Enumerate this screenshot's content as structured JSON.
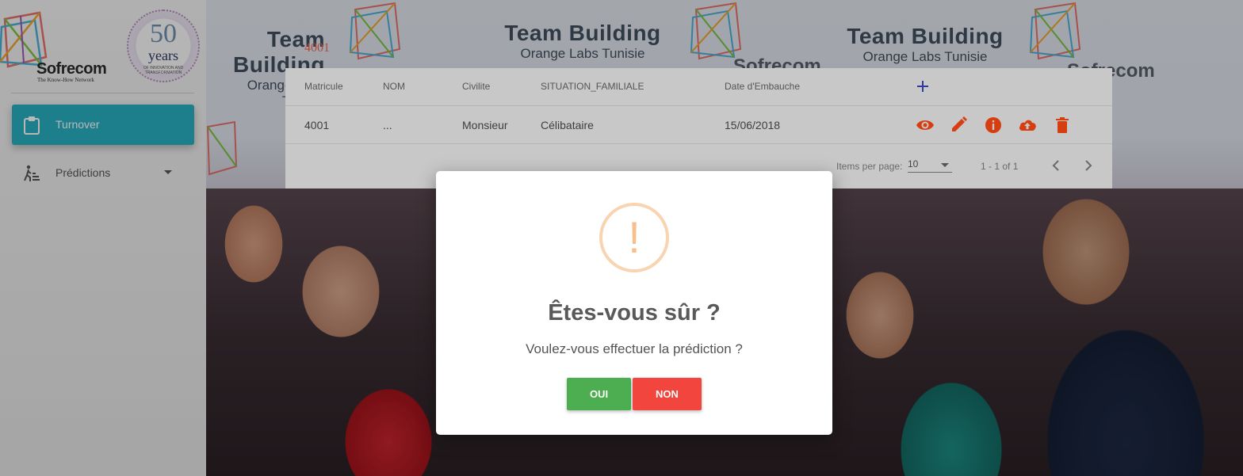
{
  "branding": {
    "company_name": "Sofrecom",
    "company_tagline": "The Know-How Network",
    "anniversary_number": "50",
    "anniversary_word": "years",
    "anniversary_subtitle": "OF INNOVATION AND TRANSFORMATION"
  },
  "sidebar": {
    "items": [
      {
        "label": "Turnover",
        "icon": "clipboard-icon",
        "active": true
      },
      {
        "label": "Prédictions",
        "icon": "walking-figure-icon",
        "active": false,
        "expandable": true
      }
    ],
    "active_color": "#2ab0c2"
  },
  "background": {
    "banner_title": "Team Building",
    "banner_subtitle": "Orange Labs Tunisie",
    "banner_brand": "Sofrecom"
  },
  "table": {
    "selected_label": "4001",
    "columns": [
      "Matricule",
      "NOM",
      "Civilite",
      "SITUATION_FAMILIALE",
      "Date d'Embauche"
    ],
    "add_icon": "plus-icon",
    "rows": [
      {
        "matricule": "4001",
        "nom": "...",
        "civilite": "Monsieur",
        "situation_familiale": "Célibataire",
        "date_embauche": "15/06/2018",
        "actions": [
          "eye-icon",
          "pencil-icon",
          "info-icon",
          "cloud-upload-icon",
          "trash-icon"
        ]
      }
    ],
    "action_color": "#d63d10",
    "paginator": {
      "items_per_page_label": "Items per page:",
      "items_per_page_value": "10",
      "range_label": "1 - 1 of 1"
    }
  },
  "dialog": {
    "icon": "exclamation-icon",
    "icon_char": "!",
    "title": "Êtes-vous sûr ?",
    "message": "Voulez-vous effectuer la prédiction ?",
    "confirm_label": "OUI",
    "cancel_label": "NON",
    "confirm_color": "#4cae50",
    "cancel_color": "#f2453d"
  }
}
